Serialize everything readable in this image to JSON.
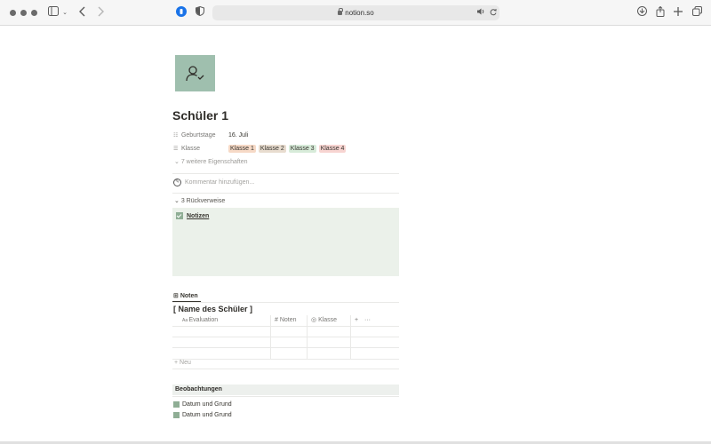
{
  "browser": {
    "url": "notion.so"
  },
  "page": {
    "title": "Schüler 1",
    "properties": [
      {
        "icon": "calendar-icon",
        "name": "Geburtstage",
        "value": "16. Juli"
      },
      {
        "icon": "list-icon",
        "name": "Klasse",
        "tags": [
          {
            "label": "Klasse 1",
            "color": "#f6d9c6"
          },
          {
            "label": "Klasse 2",
            "color": "#e8dccf"
          },
          {
            "label": "Klasse 3",
            "color": "#d7ebd9"
          },
          {
            "label": "Klasse 4",
            "color": "#f7d4d1"
          }
        ]
      }
    ],
    "more_properties": "7 weitere Eigenschaften",
    "comment_placeholder": "Kommentar hinzufügen...",
    "backlinks": {
      "label": "3 Rückverweise",
      "items": [
        "Notizen"
      ]
    },
    "database": {
      "tab": "Noten",
      "title": "[ Name des Schüler ]",
      "columns": [
        "Evaluation",
        "Noten",
        "Klasse"
      ],
      "new_row": "Neu"
    },
    "section_heading": "Beobachtungen",
    "todos": [
      "Datum und Grund",
      "Datum und Grund"
    ]
  }
}
